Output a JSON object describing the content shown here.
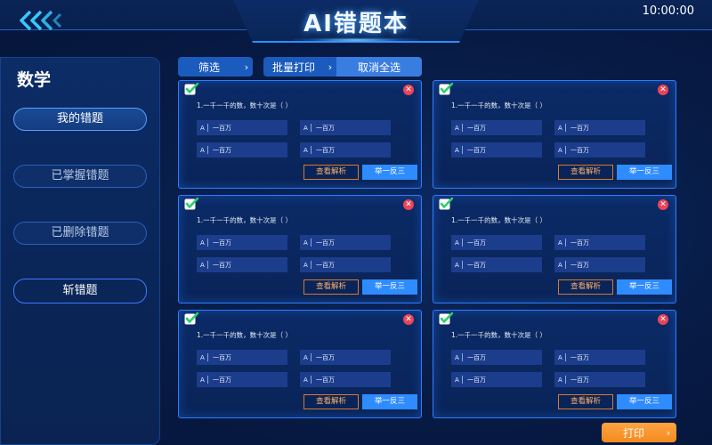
{
  "header": {
    "title": "AI错题本",
    "time": "10:00:00"
  },
  "sidebar": {
    "subject": "数学",
    "items": [
      {
        "label": "我的错题"
      },
      {
        "label": "已掌握错题"
      },
      {
        "label": "已删除错题"
      },
      {
        "label": "斩错题"
      }
    ]
  },
  "toolbar": {
    "filter_label": "筛选",
    "batch_print_label": "批量打印",
    "deselect_all_label": "取消全选"
  },
  "cards": [
    {
      "question": "1.一千一千的数，数十次是（    ）",
      "options": [
        {
          "key": "A",
          "text": "一百万"
        },
        {
          "key": "A",
          "text": "一百万"
        },
        {
          "key": "A",
          "text": "一百万"
        },
        {
          "key": "A",
          "text": "一百万"
        }
      ],
      "view_label": "查看解析",
      "similar_label": "举一反三"
    },
    {
      "question": "1.一千一千的数，数十次是（    ）",
      "options": [
        {
          "key": "A",
          "text": "一百万"
        },
        {
          "key": "A",
          "text": "一百万"
        },
        {
          "key": "A",
          "text": "一百万"
        },
        {
          "key": "A",
          "text": "一百万"
        }
      ],
      "view_label": "查看解析",
      "similar_label": "举一反三"
    },
    {
      "question": "1.一千一千的数，数十次是（    ）",
      "options": [
        {
          "key": "A",
          "text": "一百万"
        },
        {
          "key": "A",
          "text": "一百万"
        },
        {
          "key": "A",
          "text": "一百万"
        },
        {
          "key": "A",
          "text": "一百万"
        }
      ],
      "view_label": "查看解析",
      "similar_label": "举一反三"
    },
    {
      "question": "1.一千一千的数，数十次是（    ）",
      "options": [
        {
          "key": "A",
          "text": "一百万"
        },
        {
          "key": "A",
          "text": "一百万"
        },
        {
          "key": "A",
          "text": "一百万"
        },
        {
          "key": "A",
          "text": "一百万"
        }
      ],
      "view_label": "查看解析",
      "similar_label": "举一反三"
    },
    {
      "question": "1.一千一千的数，数十次是（    ）",
      "options": [
        {
          "key": "A",
          "text": "一百万"
        },
        {
          "key": "A",
          "text": "一百万"
        },
        {
          "key": "A",
          "text": "一百万"
        },
        {
          "key": "A",
          "text": "一百万"
        }
      ],
      "view_label": "查看解析",
      "similar_label": "举一反三"
    },
    {
      "question": "1.一千一千的数，数十次是（    ）",
      "options": [
        {
          "key": "A",
          "text": "一百万"
        },
        {
          "key": "A",
          "text": "一百万"
        },
        {
          "key": "A",
          "text": "一百万"
        },
        {
          "key": "A",
          "text": "一百万"
        }
      ],
      "view_label": "查看解析",
      "similar_label": "举一反三"
    }
  ],
  "footer": {
    "print_label": "打印"
  },
  "icons": {
    "back": "double-chevron-left-icon",
    "check": "checkbox-checked-icon",
    "close": "close-icon",
    "chevron": "chevron-right-icon"
  },
  "colors": {
    "accent": "#2f8cff",
    "warning": "#f48a1e",
    "danger": "#ea4456",
    "check": "#2ecf6a",
    "background": "#071b45"
  }
}
